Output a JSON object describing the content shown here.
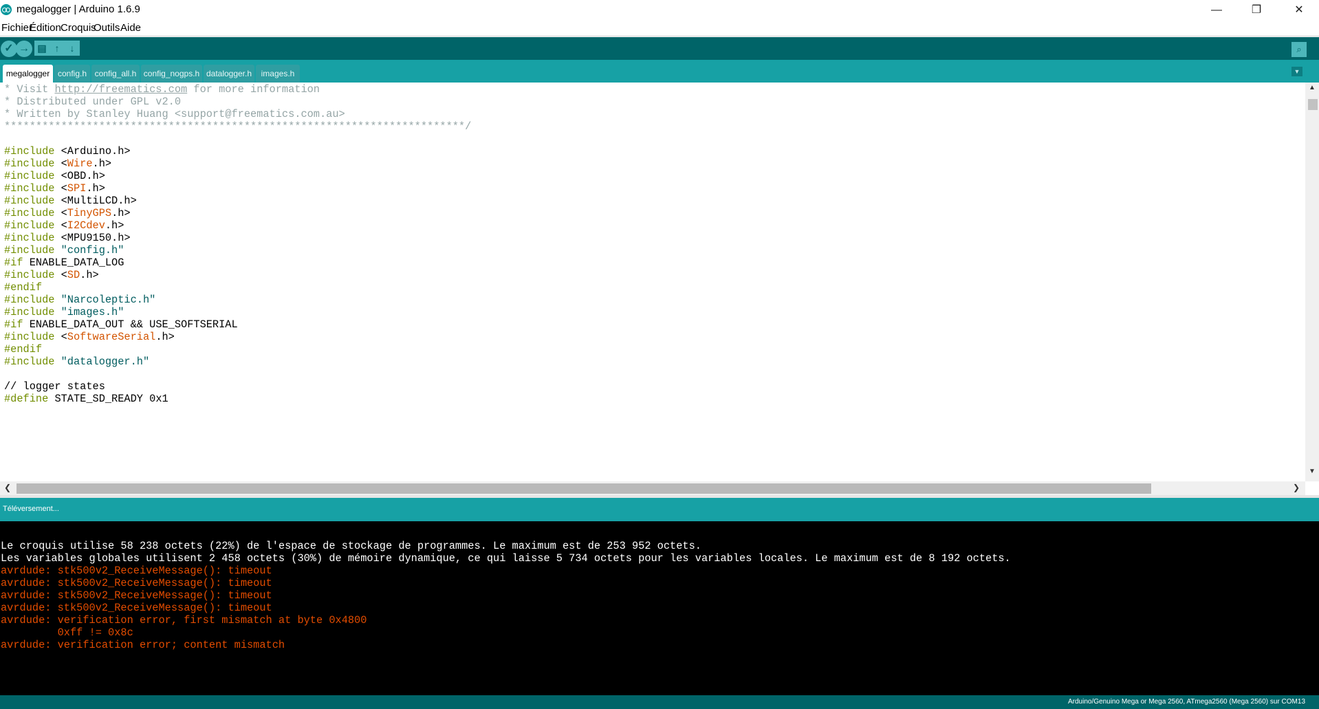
{
  "window": {
    "title": "megalogger | Arduino 1.6.9",
    "minimize_glyph": "—",
    "maximize_glyph": "❐",
    "close_glyph": "✕"
  },
  "menu": [
    "Fichier",
    "Édition",
    "Croquis",
    "Outils",
    "Aide"
  ],
  "toolbar": {
    "verify_glyph": "✓",
    "upload_glyph": "→",
    "new_glyph": "▤",
    "open_glyph": "↑",
    "save_glyph": "↓",
    "serial_monitor_glyph": "⌕"
  },
  "tabs": [
    "megalogger",
    "config.h",
    "config_all.h",
    "config_nogps.h",
    "datalogger.h",
    "images.h"
  ],
  "tab_menu_glyph": "▼",
  "code": {
    "l1_prefix": "* Visit ",
    "l1_link": "http://freematics.com",
    "l1_suffix": " for more information",
    "l2": "* Distributed under GPL v2.0",
    "l3": "* Written by Stanley Huang <support@freematics.com.au>",
    "l4": "*************************************************************************/",
    "include": "#include",
    "if": "#if",
    "endif": "#endif",
    "define": "#define",
    "lt": " <",
    "inc_arduino": "Arduino.h>",
    "inc_wire": "Wire",
    "inc_obd": "OBD.h>",
    "inc_spi": "SPI",
    "inc_multilcd": "MultiLCD.h>",
    "inc_tinygps": "TinyGPS",
    "inc_i2cdev": "I2Cdev",
    "inc_mpu": "MPU9150.h>",
    "dot_h": ".h>",
    "inc_config": " \"config.h\"",
    "if_datalog": " ENABLE_DATA_LOG",
    "inc_sd": "SD",
    "inc_narco": " \"Narcoleptic.h\"",
    "inc_images": " \"images.h\"",
    "if_dataout": " ENABLE_DATA_OUT && USE_SOFTSERIAL",
    "inc_softserial": "SoftwareSerial",
    "inc_datalogger": " \"datalogger.h\"",
    "comment_states": "// logger states",
    "define_sd": " STATE_SD_READY 0x1"
  },
  "scroll": {
    "up": "▲",
    "down": "▼",
    "left": "❮",
    "right": "❯"
  },
  "status": "Téléversement...",
  "console": [
    "Le croquis utilise 58 238 octets (22%) de l'espace de stockage de programmes. Le maximum est de 253 952 octets.",
    "Les variables globales utilisent 2 458 octets (30%) de mémoire dynamique, ce qui laisse 5 734 octets pour les variables locales. Le maximum est de 8 192 octets.",
    "avrdude: stk500v2_ReceiveMessage(): timeout",
    "avrdude: stk500v2_ReceiveMessage(): timeout",
    "avrdude: stk500v2_ReceiveMessage(): timeout",
    "avrdude: stk500v2_ReceiveMessage(): timeout",
    "avrdude: verification error, first mismatch at byte 0x4800",
    "         0xff != 0x8c",
    "avrdude: verification error; content mismatch"
  ],
  "board_info": "Arduino/Genuino Mega or Mega 2560, ATmega2560 (Mega 2560) sur COM13",
  "colors": {
    "toolbar": "#006468",
    "tabbar": "#17a1a5",
    "keyword": "#728e00",
    "library": "#d35400",
    "string": "#005c5f",
    "comment": "#95a5a6",
    "console_error": "#e34c00"
  }
}
